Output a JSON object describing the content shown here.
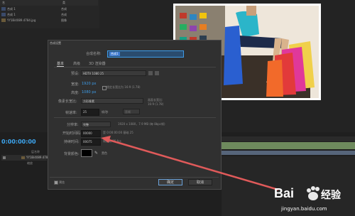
{
  "project": {
    "col_name": "名",
    "col_type": "类",
    "rows": [
      {
        "name": "合成 1",
        "type": "合成"
      },
      {
        "name": "合成 1",
        "type": "合成"
      },
      {
        "name": "YY1Bi4089.4784.jpg",
        "type": "图像"
      }
    ]
  },
  "timeline": {
    "timecode": "0:00:00:00",
    "col_name": "层名称",
    "layer_name": "YY1Bi4089.4784.jpg",
    "layer_sub": "缩放"
  },
  "dialog": {
    "title": "合成设置",
    "name_label": "合成名称:",
    "name_value": "合成1",
    "tabs": [
      "基本",
      "高级",
      "3D 渲染器"
    ],
    "preset_label": "预设:",
    "preset_value": "HDTV 1080 25",
    "width_label": "宽度:",
    "width_value": "1920 px",
    "lock_label": "锁定长宽比为 16:9 (1.78)",
    "height_label": "高度:",
    "height_value": "1080 px",
    "par_label": "像素长宽比:",
    "par_value": "方形像素",
    "frame_aspect_label": "画面长宽比:",
    "frame_aspect_value": "16:9 (1.78)",
    "fps_label": "帧速率:",
    "fps_value": "25",
    "fps_unit": "帧/秒",
    "drop_frame": "丢帧",
    "resolution_label": "分辨率:",
    "resolution_value": "完整",
    "resolution_info": "1920 x 1080，7.9 MB (每 8bpc帧)",
    "start_tc_label": "开始时间码:",
    "start_tc_value": "00000",
    "start_tc_info": "是 0:00:00:00 基础 25",
    "duration_label": "持续时间:",
    "duration_value": "00075",
    "duration_info": "帧基础 25 fps",
    "bg_label": "背景颜色:",
    "bg_color_name": "黑色",
    "preview_label": "预览",
    "ok_label": "确定",
    "cancel_label": "取消"
  },
  "watermark": {
    "brand": "Bai",
    "brand_cn": "经验",
    "url": "jingyan.baidu.com"
  },
  "colors": {
    "accent": "#3e9be6",
    "arrow": "#e05a5a",
    "dialog_bg": "#303030"
  }
}
